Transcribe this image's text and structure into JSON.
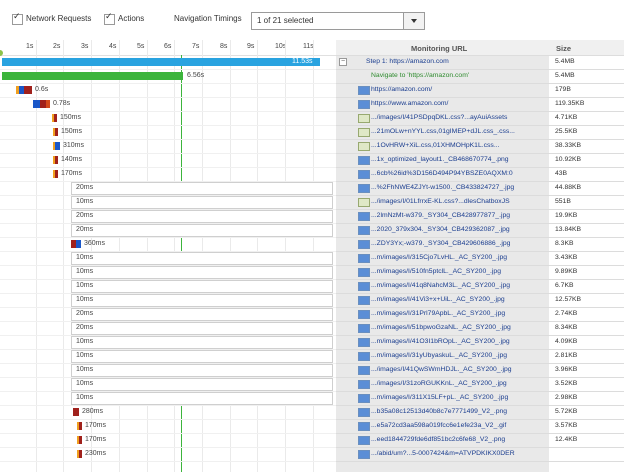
{
  "toolbar": {
    "network_requests_label": "Network Requests",
    "actions_label": "Actions",
    "navigation_timings_label": "Navigation Timings",
    "select_value": "1 of 21 selected"
  },
  "colors": {
    "step_bar": "#29a3e0",
    "nav_bar": "#3cb43c",
    "dns": "#d34a1c",
    "connect": "#1a57c8",
    "wait": "#a0211c",
    "receive": "#f0a020",
    "green_line": "#3cb43c"
  },
  "timeline": {
    "ticks": [
      "1s",
      "2s",
      "3s",
      "4s",
      "5s",
      "6s",
      "7s",
      "8s",
      "9s",
      "10s",
      "11s"
    ],
    "step_duration": "11.53s",
    "nav_duration": "6.56s"
  },
  "table": {
    "url_header": "Monitoring URL",
    "size_header": "Size",
    "step_label": "Step 1: https://amazon.com",
    "step_size": "5.4MB",
    "nav_label": "Navigate to 'https://amazon.com'",
    "nav_size": "5.4MB",
    "rows": [
      {
        "url": "https://amazon.com/",
        "size": "179B",
        "duration": "0.6s",
        "icon": "page"
      },
      {
        "url": "https://www.amazon.com/",
        "size": "119.35KB",
        "duration": "0.78s",
        "icon": "page"
      },
      {
        "url": ".../images/I/41PSDpqDKL.css?...ayAuiAssets",
        "size": "4.71KB",
        "duration": "150ms",
        "icon": "css"
      },
      {
        "url": "...21mOLw+nYYL.css,01gIMEP+dJL.css_.css...",
        "size": "25.5KB",
        "duration": "150ms",
        "icon": "css"
      },
      {
        "url": "...1OvHRW+XiL.css,01XHMOHpK1L.css...",
        "size": "38.33KB",
        "duration": "310ms",
        "icon": "css"
      },
      {
        "url": "...1x_optimized_layout1._CB468670774_.png",
        "size": "10.92KB",
        "duration": "140ms",
        "icon": "page"
      },
      {
        "url": "...6cb%26id%3D156D494P94YBSZE0AQXM:0",
        "size": "43B",
        "duration": "170ms",
        "icon": "page"
      },
      {
        "url": "...%2FhNWE4ZJYt-w1500._CB433824727_.jpg",
        "size": "44.88KB",
        "duration": "20ms",
        "icon": "page"
      },
      {
        "url": ".../images/I/01LfrrxE-KL.css?...dlesChatboxJS",
        "size": "551B",
        "duration": "10ms",
        "icon": "css"
      },
      {
        "url": "...2lmNzMt-w379._SY304_CB428977877_.jpg",
        "size": "19.9KB",
        "duration": "20ms",
        "icon": "page"
      },
      {
        "url": "...2020_379x304._SY304_CB429362087_.jpg",
        "size": "13.84KB",
        "duration": "20ms",
        "icon": "page"
      },
      {
        "url": "...ZDY3Yx;-w379._SY304_CB429606886_.jpg",
        "size": "8.3KB",
        "duration": "360ms",
        "icon": "page"
      },
      {
        "url": "...m/images/I/315Cjo7LvHL._AC_SY200_.jpg",
        "size": "3.43KB",
        "duration": "10ms",
        "icon": "page"
      },
      {
        "url": "...m/images/I/510fn5ptclL._AC_SY200_.jpg",
        "size": "9.89KB",
        "duration": "10ms",
        "icon": "page"
      },
      {
        "url": "...m/images/I/41q8NahcM3L._AC_SY200_.jpg",
        "size": "6.7KB",
        "duration": "10ms",
        "icon": "page"
      },
      {
        "url": "...m/images/I/41Vi3+x+UiL._AC_SY200_.jpg",
        "size": "12.57KB",
        "duration": "10ms",
        "icon": "page"
      },
      {
        "url": "...m/images/I/31Prl79ApbL._AC_SY200_.jpg",
        "size": "2.74KB",
        "duration": "20ms",
        "icon": "page"
      },
      {
        "url": "...m/images/I/51bpwoGzaNL._AC_SY200_.jpg",
        "size": "8.34KB",
        "duration": "20ms",
        "icon": "page"
      },
      {
        "url": "...m/images/I/41O3I1bROpL._AC_SY200_.jpg",
        "size": "4.09KB",
        "duration": "10ms",
        "icon": "page"
      },
      {
        "url": "...m/images/I/31yUbyaskuL._AC_SY200_.jpg",
        "size": "2.81KB",
        "duration": "10ms",
        "icon": "page"
      },
      {
        "url": ".../images/I/41QwSWmHDJL._AC_SY200_.jpg",
        "size": "3.96KB",
        "duration": "10ms",
        "icon": "page"
      },
      {
        "url": ".../images/I/31zoRGUKKnL._AC_SY200_.jpg",
        "size": "3.52KB",
        "duration": "10ms",
        "icon": "page"
      },
      {
        "url": "...m/images/I/311X15LF+pL._AC_SY200_.jpg",
        "size": "2.98KB",
        "duration": "10ms",
        "icon": "page"
      },
      {
        "url": "...b35a08c12513d40b8c7e7771499_V2_.png",
        "size": "5.72KB",
        "duration": "280ms",
        "icon": "page"
      },
      {
        "url": "...e5a72cd3aa598a019fcc6e1efe23a_V2_.gif",
        "size": "3.57KB",
        "duration": "170ms",
        "icon": "page"
      },
      {
        "url": "...eed1844729fde6df851bc2c6fe68_V2_.png",
        "size": "12.4KB",
        "duration": "170ms",
        "icon": "page"
      },
      {
        "url": ".../abid/um?...5-0007424&m=ATVPDKIKX0DER",
        "size": "",
        "duration": "230ms",
        "icon": "page"
      }
    ]
  }
}
